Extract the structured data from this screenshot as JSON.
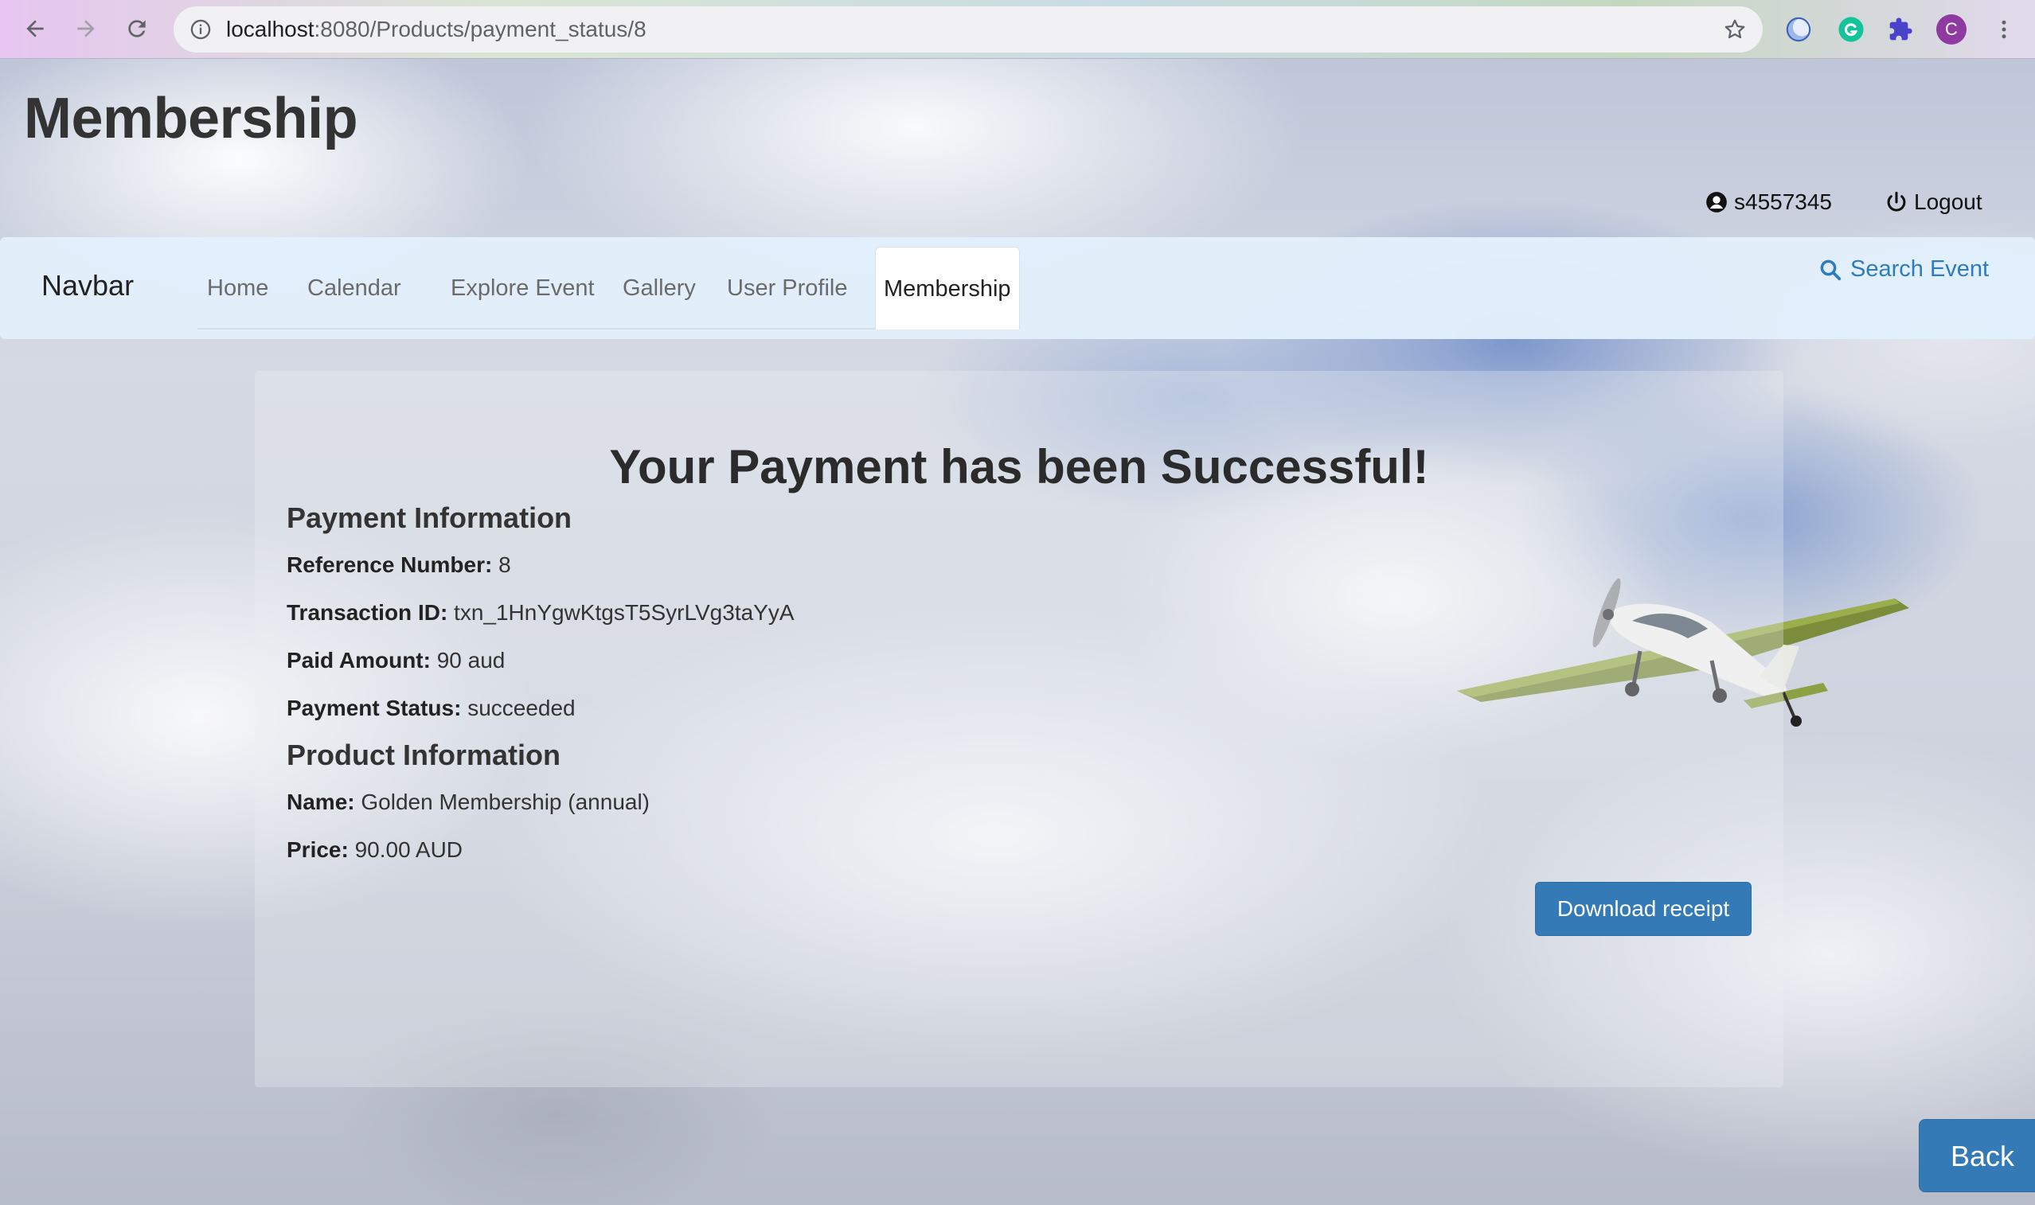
{
  "browser": {
    "url_host": "localhost",
    "url_rest": ":8080/Products/payment_status/8",
    "profile_initial": "C"
  },
  "header": {
    "title": "Membership",
    "username": "s4557345",
    "logout_label": "Logout"
  },
  "navbar": {
    "brand": "Navbar",
    "items": [
      {
        "label": "Home"
      },
      {
        "label": "Calendar"
      },
      {
        "label": "Explore Event"
      },
      {
        "label": "Gallery"
      },
      {
        "label": "User Profile"
      },
      {
        "label": "Membership",
        "active": true
      }
    ],
    "search_label": "Search Event"
  },
  "payment": {
    "headline": "Your Payment has been Successful!",
    "section_title": "Payment Information",
    "reference_label": "Reference Number:",
    "reference_value": "8",
    "transaction_label": "Transaction ID:",
    "transaction_value": "txn_1HnYgwKtgsT5SyrLVg3taYyA",
    "amount_label": "Paid Amount:",
    "amount_value": "90 aud",
    "status_label": "Payment Status:",
    "status_value": "succeeded"
  },
  "product": {
    "section_title": "Product Information",
    "name_label": "Name:",
    "name_value": "Golden Membership (annual)",
    "price_label": "Price:",
    "price_value": "90.00 AUD"
  },
  "actions": {
    "download_label": "Download receipt",
    "back_label": "Back"
  },
  "colors": {
    "primary": "#337ab7",
    "navbar_bg": "#e2f0fc",
    "link": "#2f7bbf"
  }
}
